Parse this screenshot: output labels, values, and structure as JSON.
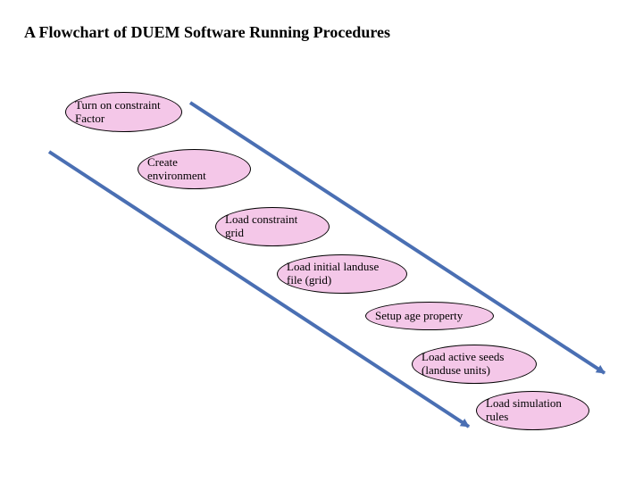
{
  "title": "A Flowchart of DUEM Software Running Procedures",
  "nodes": [
    {
      "label": "Turn on constraint\nFactor"
    },
    {
      "label": "Create\nenvironment"
    },
    {
      "label": "Load constraint\ngrid"
    },
    {
      "label": "Load initial landuse\nfile (grid)"
    },
    {
      "label": "Setup age property"
    },
    {
      "label": "Load active seeds\n(landuse units)"
    },
    {
      "label": "Load simulation\nrules"
    }
  ],
  "arrow_color": "#4a6fb3",
  "node_fill": "#f4c7e8"
}
